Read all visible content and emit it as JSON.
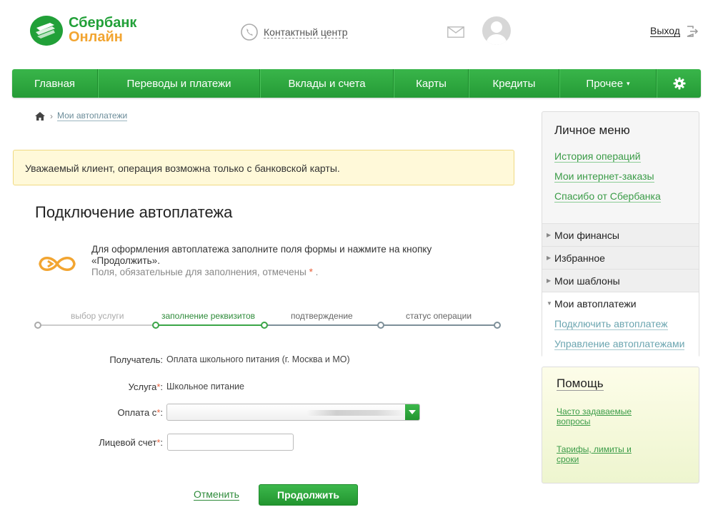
{
  "header": {
    "logo_line1": "Сбербанк",
    "logo_line2": "Онлайн",
    "contact_label": "Контактный центр",
    "logout_label": "Выход"
  },
  "nav": {
    "items": [
      {
        "label": "Главная"
      },
      {
        "label": "Переводы и платежи"
      },
      {
        "label": "Вклады и счета"
      },
      {
        "label": "Карты"
      },
      {
        "label": "Кредиты"
      },
      {
        "label": "Прочее"
      }
    ]
  },
  "breadcrumb": {
    "current": "Мои автоплатежи"
  },
  "notice": {
    "text": "Уважаемый клиент, операция возможна только с банковской карты."
  },
  "page": {
    "title": "Подключение автоплатежа",
    "intro_text": "Для оформления автоплатежа заполните поля формы и нажмите на кнопку «Продолжить».",
    "intro_note": "Поля, обязательные для заполнения, отмечены",
    "intro_note_end": "."
  },
  "steps": [
    {
      "label": "выбор услуги",
      "state": "done"
    },
    {
      "label": "заполнение реквизитов",
      "state": "active"
    },
    {
      "label": "подтверждение",
      "state": "pending"
    },
    {
      "label": "статус операции",
      "state": "pending"
    }
  ],
  "form": {
    "recipient_label": "Получатель:",
    "recipient_value": "Оплата школьного питания (г. Москва и МО)",
    "service_label": "Услуга",
    "service_value": "Школьное питание",
    "pay_from_label": "Оплата с",
    "account_label": "Лицевой счет",
    "account_value": "",
    "required_mark": "*",
    "colon": ":"
  },
  "actions": {
    "cancel_label": "Отменить",
    "continue_label": "Продолжить"
  },
  "sidebar": {
    "title": "Личное меню",
    "links": [
      {
        "label": "История операций"
      },
      {
        "label": "Мои интернет-заказы"
      },
      {
        "label": "Спасибо от Сбербанка"
      }
    ],
    "sections": [
      {
        "label": "Мои финансы"
      },
      {
        "label": "Избранное"
      },
      {
        "label": "Мои шаблоны"
      },
      {
        "label": "Мои автоплатежи"
      }
    ],
    "autopay_links": [
      {
        "label": "Подключить автоплатеж"
      },
      {
        "label": "Управление автоплатежами"
      }
    ]
  },
  "help": {
    "title": "Помощь",
    "links": [
      {
        "label": "Часто задаваемые вопросы"
      },
      {
        "label": "Тарифы, лимиты и сроки"
      }
    ]
  },
  "colors": {
    "brand_green": "#21a038",
    "brand_orange": "#f2a531",
    "notice_bg": "#fff9d9"
  }
}
